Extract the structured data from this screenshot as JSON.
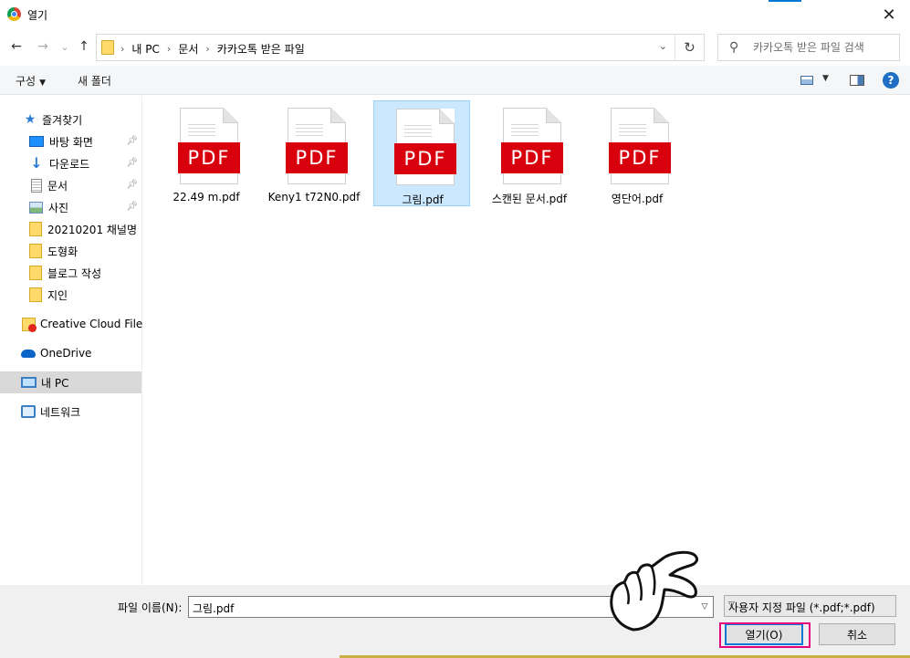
{
  "window": {
    "title": "열기",
    "close_glyph": "✕"
  },
  "nav": {
    "back_glyph": "←",
    "forward_glyph": "→",
    "recent_glyph": "⌄",
    "up_glyph": "↑",
    "breadcrumbs": [
      "내 PC",
      "문서",
      "카카오톡 받은 파일"
    ],
    "breadcrumb_sep": "›",
    "refresh_glyph": "↻",
    "search_placeholder": "카카오톡 받은 파일 검색"
  },
  "toolbar": {
    "organize_label": "구성",
    "new_folder_label": "새 폴더",
    "help_glyph": "?"
  },
  "sidebar": {
    "items": [
      {
        "label": "즐겨찾기",
        "icon": "star-icon"
      },
      {
        "label": "바탕 화면",
        "icon": "desktop-icon",
        "pinned": true
      },
      {
        "label": "다운로드",
        "icon": "download-icon",
        "pinned": true
      },
      {
        "label": "문서",
        "icon": "document-icon",
        "pinned": true
      },
      {
        "label": "사진",
        "icon": "pictures-icon",
        "pinned": true
      },
      {
        "label": "20210201 채널명",
        "icon": "folder-icon"
      },
      {
        "label": "도형화",
        "icon": "folder-icon"
      },
      {
        "label": "블로그 작성",
        "icon": "folder-icon"
      },
      {
        "label": "지인",
        "icon": "folder-icon"
      },
      {
        "label": "Creative Cloud Files",
        "icon": "creative-cloud-icon"
      },
      {
        "label": "OneDrive",
        "icon": "onedrive-icon"
      },
      {
        "label": "내 PC",
        "icon": "this-pc-icon",
        "selected": true
      },
      {
        "label": "네트워크",
        "icon": "network-icon"
      }
    ]
  },
  "files": [
    {
      "name": "22.49 m.pdf",
      "badge": "PDF"
    },
    {
      "name": "Keny1 t72N0.pdf",
      "badge": "PDF"
    },
    {
      "name": "그림.pdf",
      "badge": "PDF",
      "selected": true
    },
    {
      "name": "스캔된 문서.pdf",
      "badge": "PDF"
    },
    {
      "name": "영단어.pdf",
      "badge": "PDF"
    }
  ],
  "footer": {
    "filename_label": "파일 이름(N):",
    "filename_value": "그림.pdf",
    "filetype_value": "사용자 지정 파일 (*.pdf;*.pdf)",
    "open_label": "열기(O)",
    "cancel_label": "취소"
  },
  "colors": {
    "accent": "#0078d7",
    "pdf_red": "#d9000d",
    "selection": "#cce8ff",
    "highlight_box": "#e6007e"
  }
}
